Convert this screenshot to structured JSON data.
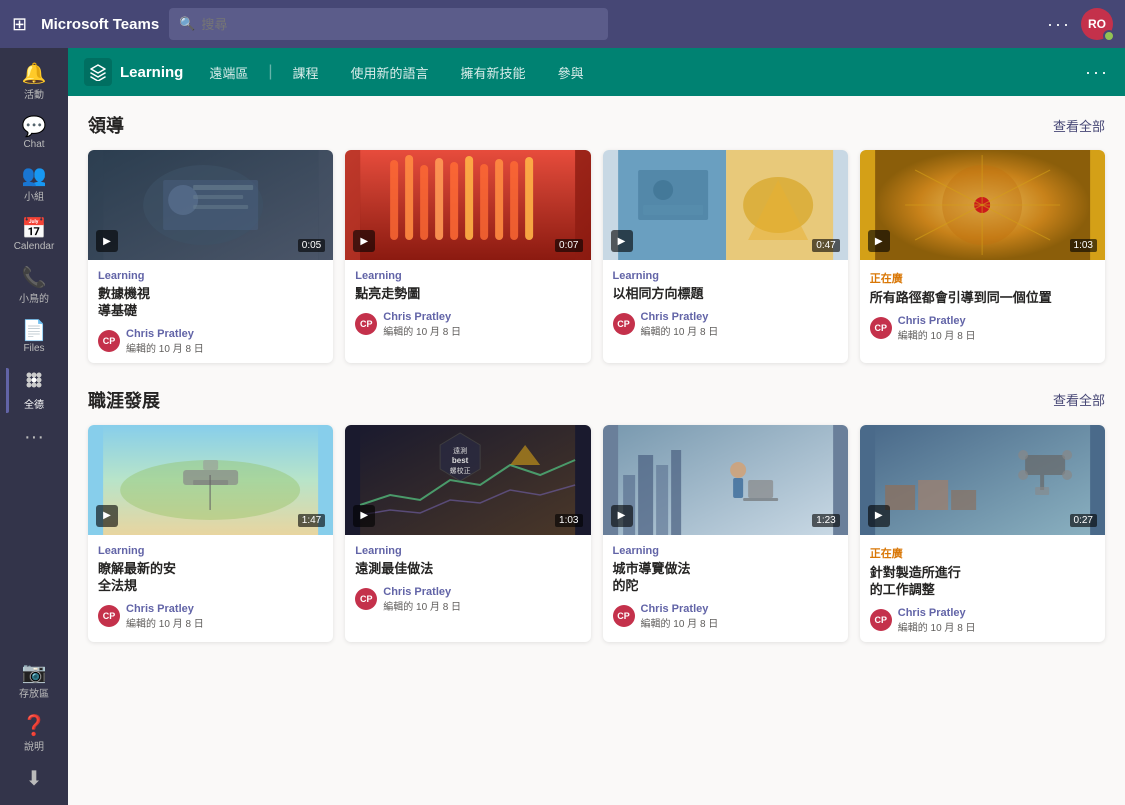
{
  "topbar": {
    "app_name": "Microsoft Teams",
    "search_placeholder": "搜尋",
    "more_label": "···",
    "avatar_initials": "RO"
  },
  "sidebar": {
    "items": [
      {
        "id": "activity",
        "label": "活動",
        "icon": "🔔"
      },
      {
        "id": "chat",
        "label": "Chat",
        "icon": "💬"
      },
      {
        "id": "teams",
        "label": "小組",
        "icon": "👥"
      },
      {
        "id": "calendar",
        "label": "Calendar",
        "icon": "📅"
      },
      {
        "id": "calls",
        "label": "小鳥的",
        "icon": "📞"
      },
      {
        "id": "files",
        "label": "Files",
        "icon": "📄"
      },
      {
        "id": "apps",
        "label": "全德",
        "icon": "⚙️"
      },
      {
        "id": "more",
        "label": "···",
        "icon": "···"
      }
    ],
    "bottom": [
      {
        "id": "meetup",
        "label": "存放區",
        "icon": "📷"
      },
      {
        "id": "help",
        "label": "說明",
        "icon": "❓"
      },
      {
        "id": "download",
        "label": "",
        "icon": "⬇"
      }
    ]
  },
  "tabbar": {
    "app_label": "Learning",
    "tabs": [
      {
        "id": "remote",
        "label": "遠端區",
        "active": false
      },
      {
        "id": "separator1",
        "label": "_",
        "is_separator": true
      },
      {
        "id": "courses",
        "label": "課程",
        "active": false
      },
      {
        "id": "new_lang",
        "label": "使用新的語言",
        "active": false
      },
      {
        "id": "new_skill",
        "label": "擁有新技能",
        "active": false
      },
      {
        "id": "participate",
        "label": "參與",
        "active": false
      },
      {
        "id": "more_tab",
        "label": "···",
        "active": false
      }
    ]
  },
  "sections": [
    {
      "id": "leadership",
      "title": "領導",
      "see_all": "查看全部",
      "cards": [
        {
          "id": "card1",
          "tag": "Learning",
          "tag_type": "purple",
          "title": "數據機視",
          "subtitle": "導基礎",
          "author_name": "Chris Pratley",
          "author_date": "編輯的 10 月 8 日",
          "duration": "0:05",
          "thumb_class": "thumb-dark",
          "thumb_type": "meeting"
        },
        {
          "id": "card2",
          "tag": "Learning",
          "tag_type": "purple",
          "title": "點亮走勢圖",
          "subtitle": "",
          "author_name": "Chris Pratley",
          "author_date": "編輯的 10 月 8 日",
          "duration": "0:07",
          "thumb_class": "thumb-red",
          "thumb_type": "fire"
        },
        {
          "id": "card3",
          "tag": "Learning",
          "tag_type": "purple",
          "title": "以相同方向標題",
          "subtitle": "",
          "author_name": "Chris Pratley",
          "author_date": "編輯的 10 月 8 日",
          "duration": "0:47",
          "thumb_class": "thumb-office",
          "thumb_type": "office"
        },
        {
          "id": "card4",
          "tag": "正在廣",
          "tag_type": "orange",
          "title": "所有路徑都會引導到同一個位置",
          "subtitle": "",
          "author_name": "Chris Pratley",
          "author_date": "編輯的 10 月 8 日",
          "duration": "1:03",
          "thumb_class": "thumb-gold",
          "thumb_type": "abstract"
        }
      ]
    },
    {
      "id": "career",
      "title": "職涯發展",
      "see_all": "查看全部",
      "cards": [
        {
          "id": "card5",
          "tag": "Learning",
          "tag_type": "purple",
          "title": "瞭解最新的安",
          "subtitle": "全法規",
          "author_name": "Chris Pratley",
          "author_date": "編輯的 10 月 8 日",
          "duration": "1:47",
          "thumb_class": "thumb-sky",
          "thumb_type": "drone"
        },
        {
          "id": "card6",
          "tag": "Learning",
          "tag_type": "purple",
          "title": "遠測最佳做法",
          "subtitle": "",
          "author_name": "Chris Pratley",
          "author_date": "編輯的 10 月 8 日",
          "duration": "1:03",
          "thumb_class": "thumb-dark2",
          "thumb_type": "data"
        },
        {
          "id": "card7",
          "tag": "Learning",
          "tag_type": "purple",
          "title": "城市導覽做法",
          "subtitle": "的陀",
          "author_name": "Chris Pratley",
          "author_date": "編輯的 10 月 8 日",
          "duration": "1:23",
          "thumb_class": "thumb-city",
          "thumb_type": "city"
        },
        {
          "id": "card8",
          "tag": "正在廣",
          "tag_type": "orange",
          "title": "針對製造所進行",
          "subtitle": "的工作調整",
          "author_name": "Chris Pratley",
          "author_date": "編輯的 10 月 8 日",
          "duration": "0:27",
          "thumb_class": "thumb-drone2",
          "thumb_type": "warehouse"
        }
      ]
    }
  ]
}
